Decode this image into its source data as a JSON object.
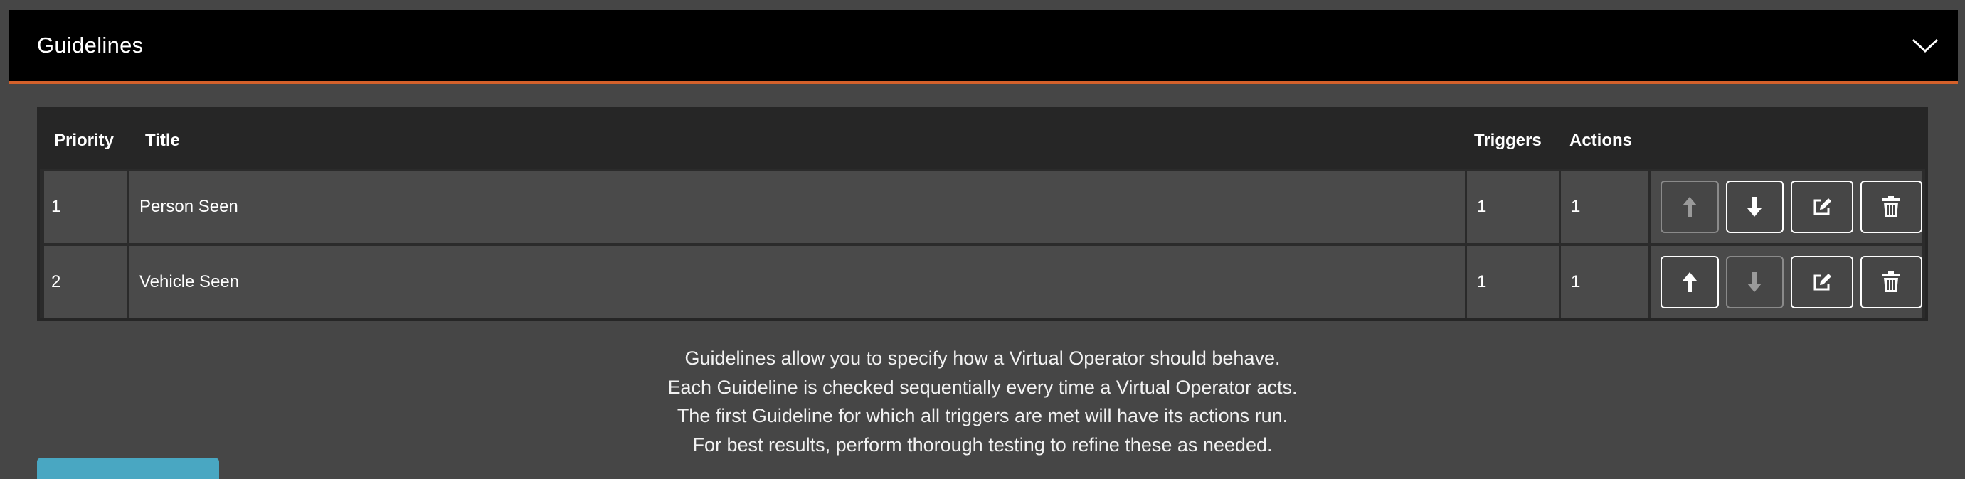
{
  "panel": {
    "title": "Guidelines",
    "collapse_icon": "chevron-down-icon"
  },
  "table": {
    "headers": {
      "priority": "Priority",
      "title": "Title",
      "triggers": "Triggers",
      "actions": "Actions"
    },
    "rows": [
      {
        "priority": "1",
        "title": "Person Seen",
        "triggers": "1",
        "actions": "1",
        "move_up_enabled": false,
        "move_down_enabled": true
      },
      {
        "priority": "2",
        "title": "Vehicle Seen",
        "triggers": "1",
        "actions": "1",
        "move_up_enabled": true,
        "move_down_enabled": false
      }
    ],
    "row_buttons": [
      "arrow-up-icon",
      "arrow-down-icon",
      "edit-icon",
      "trash-icon"
    ]
  },
  "help": {
    "line1": "Guidelines allow you to specify how a Virtual Operator should behave.",
    "line2": "Each Guideline is checked sequentially every time a Virtual Operator acts.",
    "line3": "The first Guideline for which all triggers are met will have its actions run.",
    "line4": "For best results, perform thorough testing to refine these as needed."
  },
  "colors": {
    "accent": "#d4612b",
    "button": "#49a7c2",
    "background": "#464646",
    "header": "#000000"
  }
}
